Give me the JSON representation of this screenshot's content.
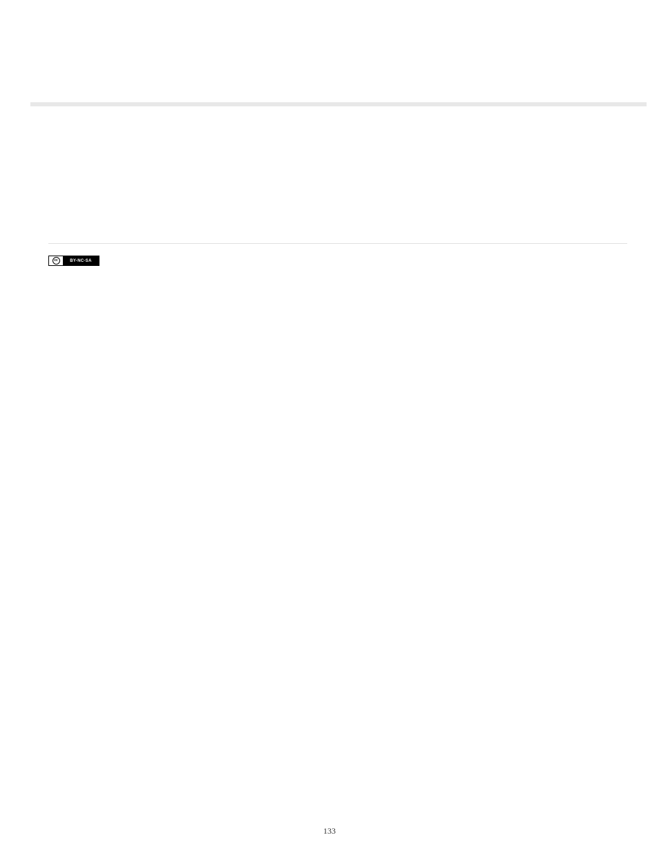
{
  "license_badge": {
    "cc_text": "cc",
    "terms": "BY-NC-SA"
  },
  "page_number": "133"
}
